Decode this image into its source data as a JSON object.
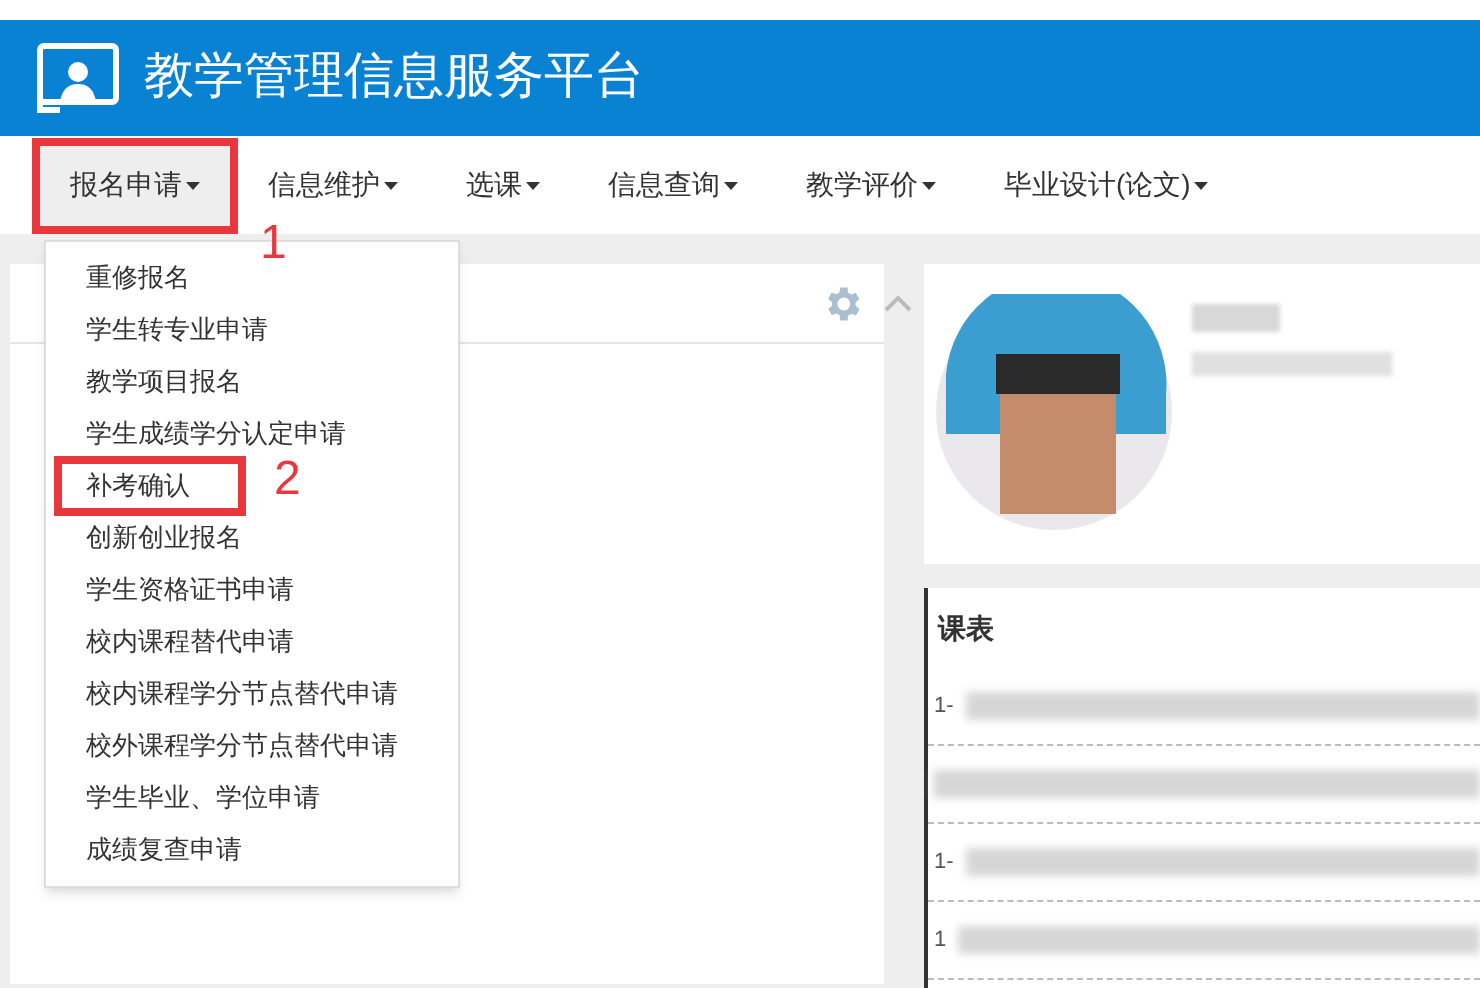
{
  "header": {
    "title": "教学管理信息服务平台"
  },
  "nav": [
    {
      "label": "报名申请",
      "selected": true,
      "highlighted": true,
      "annotation": "1"
    },
    {
      "label": "信息维护",
      "selected": false,
      "highlighted": false
    },
    {
      "label": "选课",
      "selected": false,
      "highlighted": false
    },
    {
      "label": "信息查询",
      "selected": false,
      "highlighted": false
    },
    {
      "label": "教学评价",
      "selected": false,
      "highlighted": false
    },
    {
      "label": "毕业设计(论文)",
      "selected": false,
      "highlighted": false
    }
  ],
  "menu": [
    {
      "label": "重修报名",
      "highlighted": false
    },
    {
      "label": "学生转专业申请",
      "highlighted": false
    },
    {
      "label": "教学项目报名",
      "highlighted": false
    },
    {
      "label": "学生成绩学分认定申请",
      "highlighted": false
    },
    {
      "label": "补考确认",
      "highlighted": true,
      "annotation": "2"
    },
    {
      "label": "创新创业报名",
      "highlighted": false
    },
    {
      "label": "学生资格证书申请",
      "highlighted": false
    },
    {
      "label": "校内课程替代申请",
      "highlighted": false
    },
    {
      "label": "校内课程学分节点替代申请",
      "highlighted": false
    },
    {
      "label": "校外课程学分节点替代申请",
      "highlighted": false
    },
    {
      "label": "学生毕业、学位申请",
      "highlighted": false
    },
    {
      "label": "成绩复查申请",
      "highlighted": false
    }
  ],
  "schedule": {
    "title": "课表",
    "rows": [
      {
        "prefix": "1-"
      },
      {},
      {
        "prefix": "1-"
      },
      {
        "prefix": "1"
      }
    ]
  }
}
